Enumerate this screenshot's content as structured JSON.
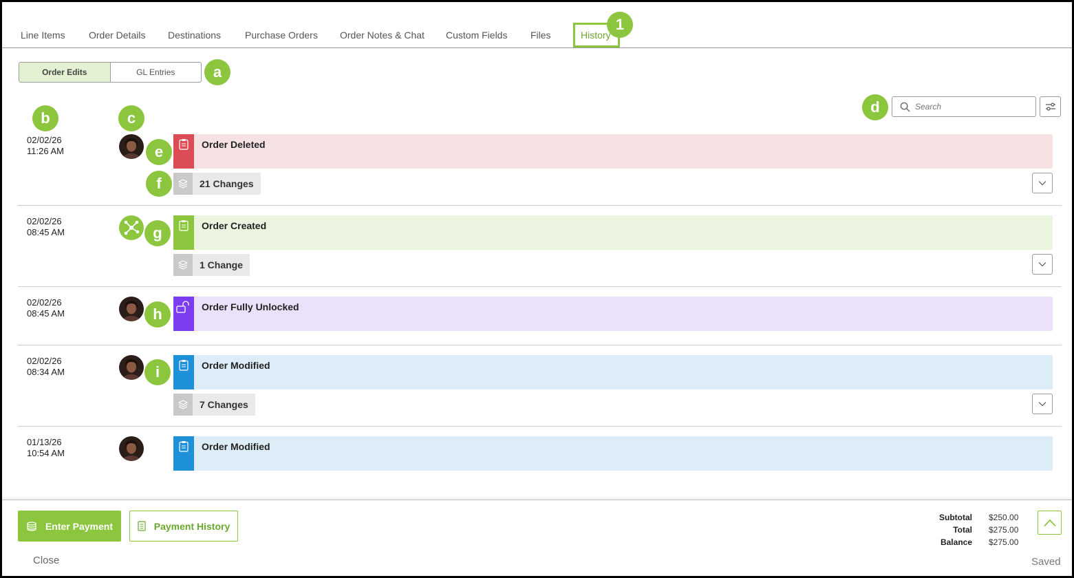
{
  "tabs": [
    {
      "label": "Line Items",
      "active": false
    },
    {
      "label": "Order Details",
      "active": false
    },
    {
      "label": "Destinations",
      "active": false
    },
    {
      "label": "Purchase Orders",
      "active": false
    },
    {
      "label": "Order Notes & Chat",
      "active": false
    },
    {
      "label": "Custom Fields",
      "active": false
    },
    {
      "label": "Files",
      "active": false
    },
    {
      "label": "History",
      "active": true
    }
  ],
  "segment": {
    "order_edits": "Order Edits",
    "gl_entries": "GL Entries",
    "active": "Order Edits"
  },
  "search": {
    "placeholder": "Search",
    "value": ""
  },
  "callouts": {
    "one": "1",
    "a": "a",
    "b": "b",
    "c": "c",
    "d": "d",
    "e": "e",
    "f": "f",
    "g": "g",
    "h": "h",
    "i": "i"
  },
  "entries": [
    {
      "date": "02/02/26",
      "time": "11:26 AM",
      "actor": "user-avatar",
      "title": "Order Deleted",
      "changes": "21 Changes",
      "color": "#f7e2e3",
      "accent": "#dc4c56",
      "icon": "clipboard-icon"
    },
    {
      "date": "02/02/26",
      "time": "08:45 AM",
      "actor": "system-network-icon",
      "title": "Order Created",
      "changes": "1 Change",
      "color": "#ebf4df",
      "accent": "#8cc63f",
      "icon": "clipboard-icon"
    },
    {
      "date": "02/02/26",
      "time": "08:45 AM",
      "actor": "user-avatar",
      "title": "Order Fully Unlocked",
      "changes": "",
      "color": "#ebe1fa",
      "accent": "#7c3cef",
      "icon": "unlock-icon"
    },
    {
      "date": "02/02/26",
      "time": "08:34 AM",
      "actor": "user-avatar",
      "title": "Order Modified",
      "changes": "7 Changes",
      "color": "#dcedf7",
      "accent": "#1e90d8",
      "icon": "clipboard-icon"
    },
    {
      "date": "01/13/26",
      "time": "10:54 AM",
      "actor": "user-avatar",
      "title": "Order Modified",
      "changes": "",
      "color": "#dcedf7",
      "accent": "#1e90d8",
      "icon": "clipboard-icon"
    }
  ],
  "footer": {
    "enter_payment": "Enter Payment",
    "payment_history": "Payment History",
    "close": "Close",
    "saved": "Saved",
    "subtotal_label": "Subtotal",
    "subtotal_value": "$250.00",
    "total_label": "Total",
    "total_value": "$275.00",
    "balance_label": "Balance",
    "balance_value": "$275.00"
  },
  "colors": {
    "brand_green": "#8cc63f",
    "active_tab": "#6aa82c"
  }
}
